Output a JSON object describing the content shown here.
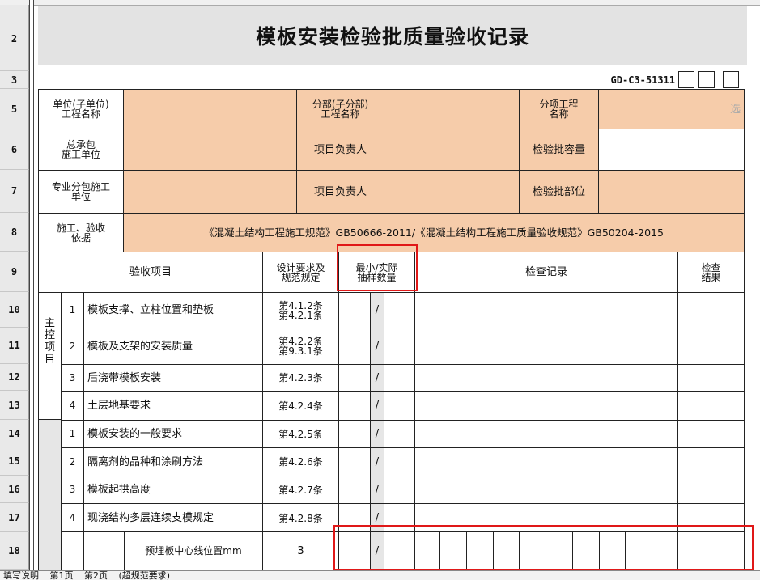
{
  "sheet": {
    "title": "模板安装检验批质量验收记录",
    "code": "GD-C3-51311",
    "row_numbers": [
      "2",
      "3",
      "5",
      "6",
      "7",
      "8",
      "9",
      "10",
      "11",
      "12",
      "13",
      "14",
      "15",
      "16",
      "17",
      "18"
    ]
  },
  "header": {
    "unit_label": "单位(子单位)\n工程名称",
    "subdivision_label": "分部(子分部)\n工程名称",
    "item_label": "分项工程\n名称",
    "select_hint": "选",
    "contractor_label": "总承包\n施工单位",
    "pm_label": "项目负责人",
    "batch_capacity_label": "检验批容量",
    "subcontractor_label": "专业分包施工\n单位",
    "pm_label2": "项目负责人",
    "batch_part_label": "检验批部位",
    "basis_label": "施工、验收\n依据",
    "basis_value": "《混凝土结构工程施工规范》GB50666-2011/《混凝土结构工程施工质量验收规范》GB50204-2015"
  },
  "columns": {
    "item": "验收项目",
    "design": "设计要求及\n规范规定",
    "sample": "最小/实际\n抽样数量",
    "record": "检查记录",
    "result": "检查\n结果"
  },
  "main_group_label": "主\n控\n项\n目",
  "rows": [
    {
      "no": "1",
      "name": "模板支撑、立柱位置和垫板",
      "clause": "第4.1.2条\n第4.2.1条",
      "slash": "/"
    },
    {
      "no": "2",
      "name": "模板及支架的安装质量",
      "clause": "第4.2.2条\n第9.3.1条",
      "slash": "/"
    },
    {
      "no": "3",
      "name": "后浇带模板安装",
      "clause": "第4.2.3条",
      "slash": "/"
    },
    {
      "no": "4",
      "name": "土层地基要求",
      "clause": "第4.2.4条",
      "slash": "/"
    },
    {
      "no": "1",
      "name": "模板安装的一般要求",
      "clause": "第4.2.5条",
      "slash": "/"
    },
    {
      "no": "2",
      "name": "隔离剂的品种和涂刷方法",
      "clause": "第4.2.6条",
      "slash": "/"
    },
    {
      "no": "3",
      "name": "模板起拱高度",
      "clause": "第4.2.7条",
      "slash": "/"
    },
    {
      "no": "4",
      "name": "现浇结构多层连续支模规定",
      "clause": "第4.2.8条",
      "slash": "/"
    }
  ],
  "row18": {
    "name": "预埋板中心线位置mm",
    "value": "3",
    "slash": "/"
  },
  "tabs": [
    "填写说明",
    "第1页",
    "第2页",
    "(超规范要求)"
  ]
}
